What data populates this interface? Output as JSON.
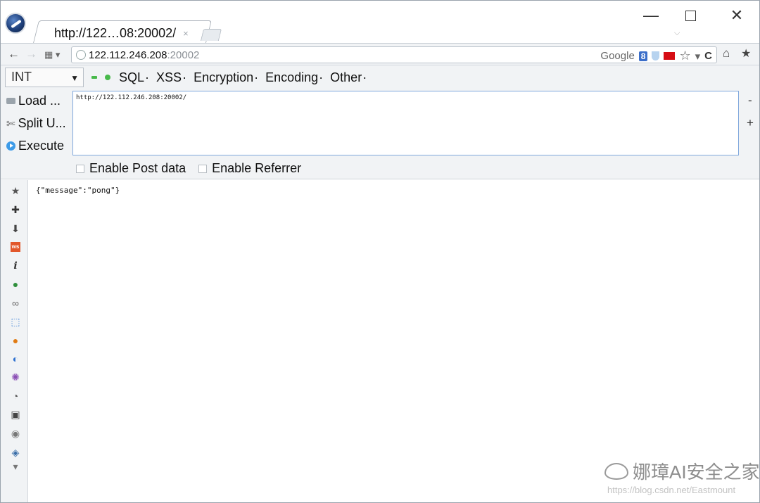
{
  "tab": {
    "title": "http://122…08:20002/",
    "close": "×"
  },
  "window": {
    "minimize": "—",
    "close": "✕"
  },
  "nav": {
    "back": "←",
    "forward": "→",
    "apps": "▦ ▾",
    "url_host": "122.112.246.208",
    "url_port": ":20002",
    "search_engine": "Google",
    "search_badge": "8",
    "bookmark_star": "☆",
    "dropdown": "▾",
    "reload": "C",
    "home": "⌂",
    "bookmarks": "★"
  },
  "hackbar": {
    "select_value": "INT",
    "menus": [
      "SQL",
      "XSS",
      "Encryption",
      "Encoding",
      "Other"
    ],
    "load_label": "Load ...",
    "split_label": "Split U...",
    "execute_label": "Execute",
    "url_value": "http://122.112.246.208:20002/",
    "minus": "-",
    "plus": "+",
    "post_label": "Enable Post data",
    "referrer_label": "Enable Referrer"
  },
  "sidebar_icons": [
    {
      "name": "bookmark-star-icon",
      "glyph": "★",
      "color": "#555555"
    },
    {
      "name": "addons-puzzle-icon",
      "glyph": "✚",
      "color": "#333333"
    },
    {
      "name": "download-arrow-icon",
      "glyph": "⬇",
      "color": "#444444"
    },
    {
      "name": "ws-icon",
      "glyph": "ws",
      "color": "#e2572b"
    },
    {
      "name": "info-icon",
      "glyph": "i",
      "color": "#333333"
    },
    {
      "name": "green-ball-icon",
      "glyph": "●",
      "color": "#2f8f3c"
    },
    {
      "name": "glasses-icon",
      "glyph": "∞",
      "color": "#666666"
    },
    {
      "name": "pointer-select-icon",
      "glyph": "⬚",
      "color": "#3a7fd5"
    },
    {
      "name": "warning-circle-icon",
      "glyph": "●",
      "color": "#e07b13"
    },
    {
      "name": "swirl-icon",
      "glyph": "◐",
      "color": "#2c6fd0"
    },
    {
      "name": "virus-icon",
      "glyph": "✺",
      "color": "#8b4fb5"
    },
    {
      "name": "palette-icon",
      "glyph": "◔",
      "color": "#555555"
    },
    {
      "name": "screen-grid-icon",
      "glyph": "▣",
      "color": "#444444"
    },
    {
      "name": "bulb-icon",
      "glyph": "◉",
      "color": "#777777"
    },
    {
      "name": "shield-tag-icon",
      "glyph": "◈",
      "color": "#3a6ea8"
    },
    {
      "name": "more-down-icon",
      "glyph": "▾",
      "color": "#777777"
    }
  ],
  "content": {
    "response": "{\"message\":\"pong\"}"
  },
  "watermark": {
    "title": "娜璋AI安全之家",
    "url": "https://blog.csdn.net/Eastmount"
  }
}
